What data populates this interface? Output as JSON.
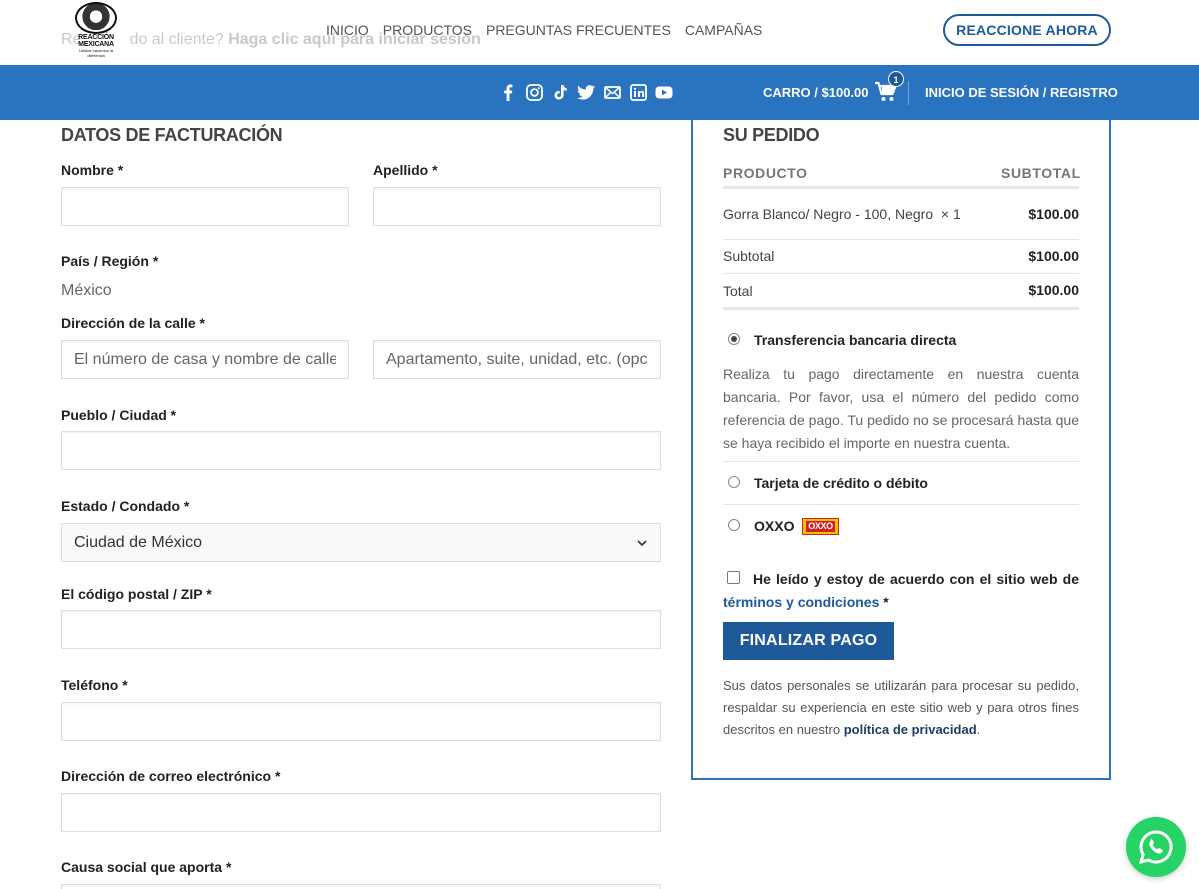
{
  "header": {
    "returning_prefix": "Re",
    "returning_mid": "do al cliente?",
    "returning_link": "Haga clic aquí para iniciar sesión",
    "logo_line1": "REACCIÓN",
    "logo_line2": "MEXICANA",
    "logo_tagline": "Unidos hacemos la diferencia",
    "nav": [
      "INICIO",
      "PRODUCTOS",
      "PREGUNTAS FRECUENTES",
      "CAMPAÑAS"
    ],
    "cta": "REACCIONE AHORA"
  },
  "bluebar": {
    "social_icons": [
      "facebook-icon",
      "instagram-icon",
      "tiktok-icon",
      "twitter-icon",
      "email-icon",
      "linkedin-icon",
      "youtube-icon"
    ],
    "cart_label": "CARRO / $100.00",
    "cart_count": "1",
    "login_label": "INICIO DE SESIÓN / REGISTRO"
  },
  "billing": {
    "title": "DATOS DE FACTURACIÓN",
    "first_name_label": "Nombre",
    "last_name_label": "Apellido",
    "country_label": "País / Región",
    "country_value": "México",
    "street_label": "Dirección de la calle",
    "street_placeholder": "El número de casa y nombre de calle",
    "street2_placeholder": "Apartamento, suite, unidad, etc. (opcional)",
    "city_label": "Pueblo / Ciudad",
    "state_label": "Estado / Condado",
    "state_value": "Ciudad de México",
    "zip_label": "El código postal / ZIP",
    "phone_label": "Teléfono",
    "email_label": "Dirección de correo electrónico",
    "cause_label": "Causa social que aporta",
    "required_mark": "*"
  },
  "order": {
    "title": "SU PEDIDO",
    "col_product": "PRODUCTO",
    "col_subtotal": "SUBTOTAL",
    "item_name": "Gorra Blanco/ Negro - 100, Negro",
    "item_qty": "× 1",
    "item_price": "$100.00",
    "subtotal_label": "Subtotal",
    "subtotal_value": "$100.00",
    "total_label": "Total",
    "total_value": "$100.00",
    "payment_methods": [
      {
        "label": "Transferencia bancaria directa",
        "checked": true
      },
      {
        "label": "Tarjeta de crédito o débito",
        "checked": false
      },
      {
        "label": "OXXO",
        "checked": false
      }
    ],
    "bank_description": "Realiza tu pago directamente en nuestra cuenta bancaria. Por favor, usa el número del pedido como referencia de pago. Tu pedido no se procesará hasta que se haya recibido el importe en nuestra cuenta.",
    "oxxo_logo_text": "OXXO",
    "terms_text": "He leído y estoy de acuerdo con el sitio web de",
    "terms_link": "términos y condiciones",
    "terms_req": "*",
    "submit": "FINALIZAR PAGO",
    "privacy_text": "Sus datos personales se utilizarán para procesar su pedido, respaldar su experiencia en este sitio web y para otros fines descritos en nuestro",
    "privacy_link": "política de privacidad",
    "privacy_end": "."
  },
  "colors": {
    "brand_blue": "#2a73bf",
    "button_blue": "#1e5a9a",
    "whatsapp_green": "#25d366"
  }
}
